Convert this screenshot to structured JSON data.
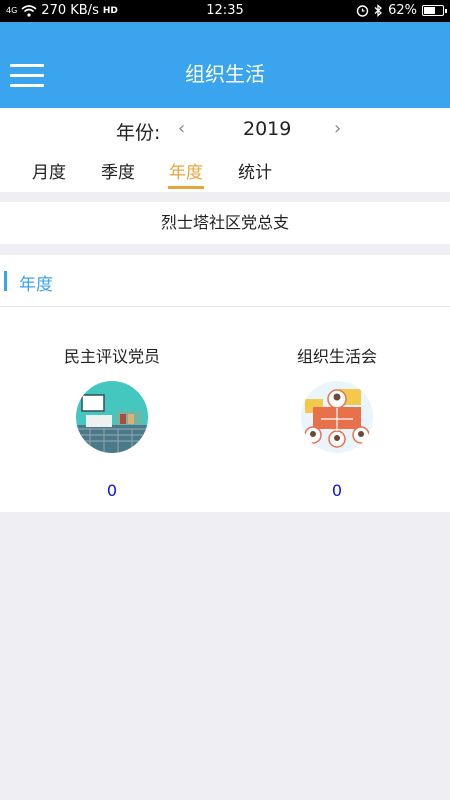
{
  "status": {
    "network": "4G",
    "speed": "270 KB/s",
    "hd": "HD",
    "time": "12:35",
    "battery": "62%",
    "battery_level": 0.62
  },
  "header": {
    "title": "组织生活",
    "menu_icon": "hamburger-icon"
  },
  "year_selector": {
    "label": "年份:",
    "value": "2019",
    "prev": "‹",
    "next": "›"
  },
  "tabs": [
    {
      "label": "月度",
      "active": false
    },
    {
      "label": "季度",
      "active": false
    },
    {
      "label": "年度",
      "active": true
    },
    {
      "label": "统计",
      "active": false
    }
  ],
  "organization": "烈士塔社区党总支",
  "section": {
    "title": "年度",
    "cards": [
      {
        "title": "民主评议党员",
        "icon": "classroom-icon",
        "count": "0"
      },
      {
        "title": "组织生活会",
        "icon": "meeting-people-icon",
        "count": "0"
      }
    ]
  },
  "colors": {
    "primary": "#3aa4ee",
    "accent": "#e8a53c",
    "count": "#1010d8",
    "background": "#eeeef3"
  }
}
